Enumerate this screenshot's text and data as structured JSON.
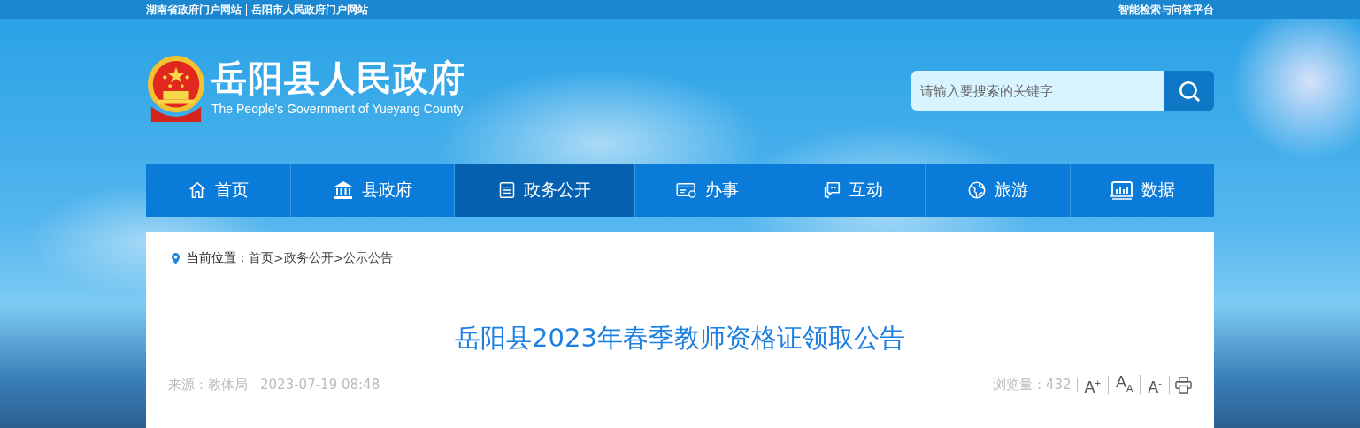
{
  "top_bar": {
    "links": [
      "湖南省政府门户网站",
      "岳阳市人民政府门户网站"
    ],
    "right_link": "智能检索与问答平台"
  },
  "header": {
    "title": "岳阳县人民政府",
    "subtitle": "The People's Government of Yueyang County",
    "search": {
      "placeholder": "请输入要搜索的关键字"
    }
  },
  "nav": [
    {
      "label": "首页",
      "selected": false
    },
    {
      "label": "县政府",
      "selected": false
    },
    {
      "label": "政务公开",
      "selected": true
    },
    {
      "label": "办事",
      "selected": false
    },
    {
      "label": "互动",
      "selected": false
    },
    {
      "label": "旅游",
      "selected": false
    },
    {
      "label": "数据",
      "selected": false
    }
  ],
  "breadcrumb": {
    "label": "当前位置：",
    "separator": ">",
    "items": [
      "首页",
      "政务公开",
      "公示公告"
    ]
  },
  "article": {
    "title": "岳阳县2023年春季教师资格证领取公告",
    "source": "来源：教体局",
    "date": "2023-07-19 08:48",
    "views": "浏览量：432",
    "font_buttons": [
      "A$^{+}$",
      "A$_{A}$",
      "A$^{-}$"
    ]
  }
}
